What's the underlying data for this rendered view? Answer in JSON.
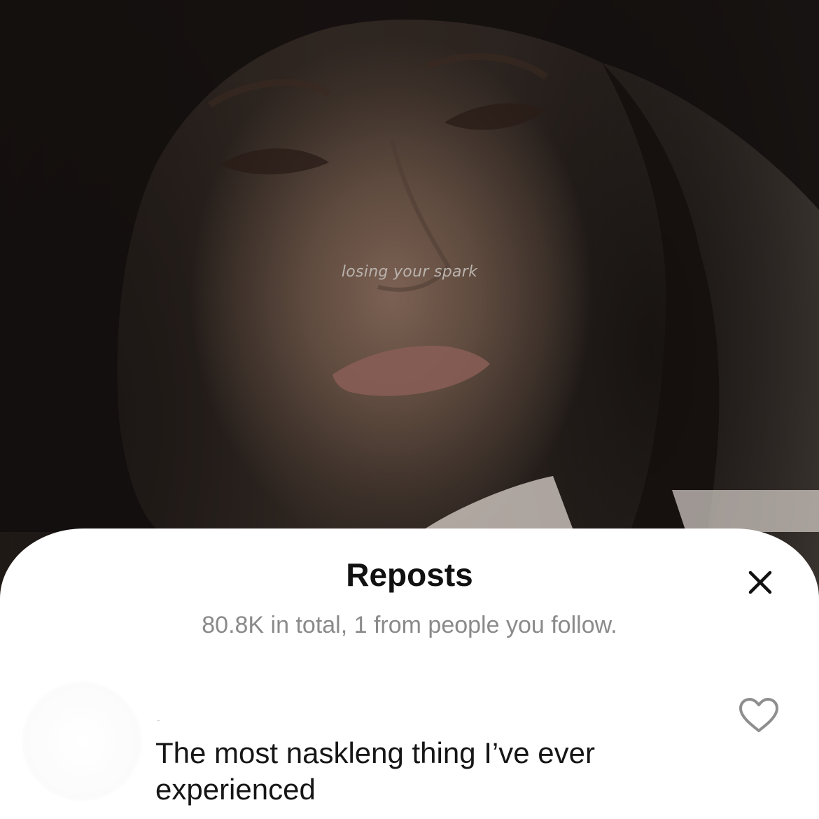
{
  "video": {
    "caption": "losing your spark"
  },
  "sheet": {
    "title": "Reposts",
    "subtitle": "80.8K in total, 1 from people you follow.",
    "close_icon": "close-icon"
  },
  "reposts": [
    {
      "username": "-",
      "text": "The most naskleng thing I’ve ever experienced",
      "like_icon": "heart-outline-icon"
    }
  ]
}
